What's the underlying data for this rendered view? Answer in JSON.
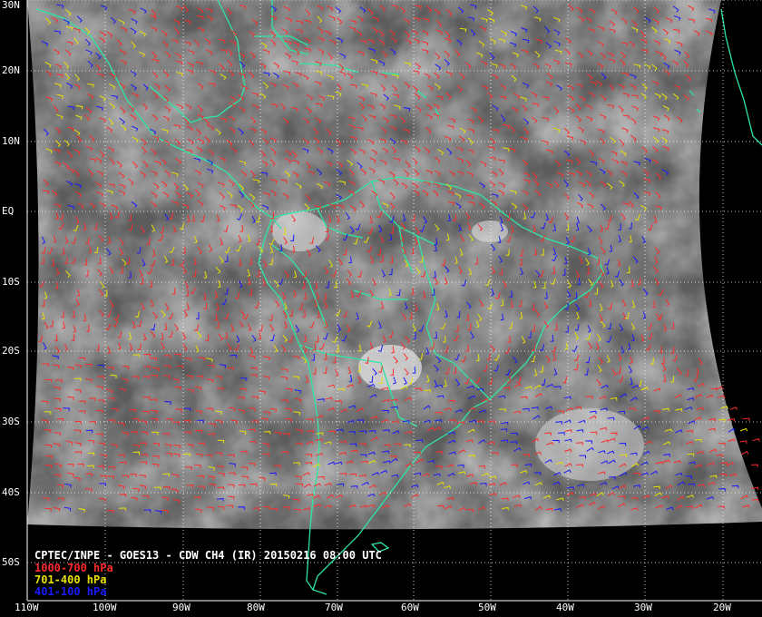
{
  "title": "CPTEC/INPE - GOES13 - CDW CH4 (IR) 20150216 08:00 UTC",
  "legend": [
    {
      "label": "1000-700 hPa",
      "color": "#ff2a2a"
    },
    {
      "label": "701-400 hPa",
      "color": "#e8e000"
    },
    {
      "label": "401-100 hPa",
      "color": "#1a1aff"
    }
  ],
  "lat_labels": [
    "30N",
    "20N",
    "10N",
    "EQ",
    "10S",
    "20S",
    "30S",
    "40S",
    "50S"
  ],
  "lon_labels": [
    "110W",
    "100W",
    "90W",
    "80W",
    "70W",
    "60W",
    "50W",
    "40W",
    "30W",
    "20W"
  ],
  "coastline_color": "#2ee6a0",
  "grid_style": "dotted white",
  "background": "black"
}
